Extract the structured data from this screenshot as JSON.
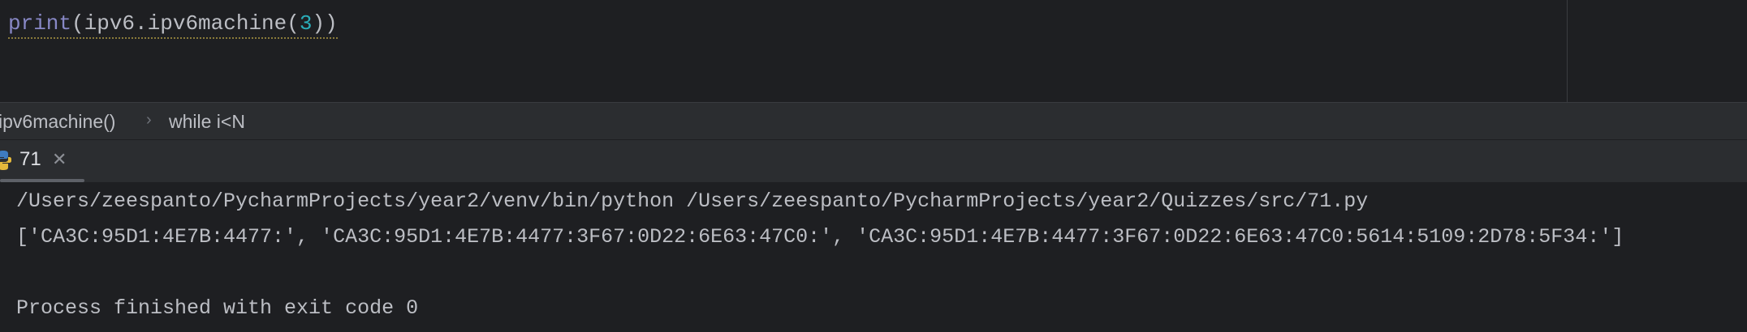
{
  "editor": {
    "code": {
      "func": "print",
      "open_paren": "(",
      "call": "ipv6.ipv6machine",
      "open_paren2": "(",
      "arg": "3",
      "close": "))"
    }
  },
  "breadcrumbs": {
    "items": [
      "ipv6machine()",
      "while i<N"
    ],
    "separator": "›"
  },
  "run_tabs": {
    "tabs": [
      {
        "label": "71",
        "icon": "python-icon",
        "active": true
      }
    ]
  },
  "console": {
    "lines": [
      "/Users/zeespanto/PycharmProjects/year2/venv/bin/python /Users/zeespanto/PycharmProjects/year2/Quizzes/src/71.py",
      "['CA3C:95D1:4E7B:4477:', 'CA3C:95D1:4E7B:4477:3F67:0D22:6E63:47C0:', 'CA3C:95D1:4E7B:4477:3F67:0D22:6E63:47C0:5614:5109:2D78:5F34:']",
      "",
      "Process finished with exit code 0"
    ]
  },
  "colors": {
    "editor_bg": "#1e1f22",
    "panel_bg": "#2b2d30",
    "text": "#bcbec4",
    "builtin": "#8888c6",
    "number": "#2aacb8"
  }
}
